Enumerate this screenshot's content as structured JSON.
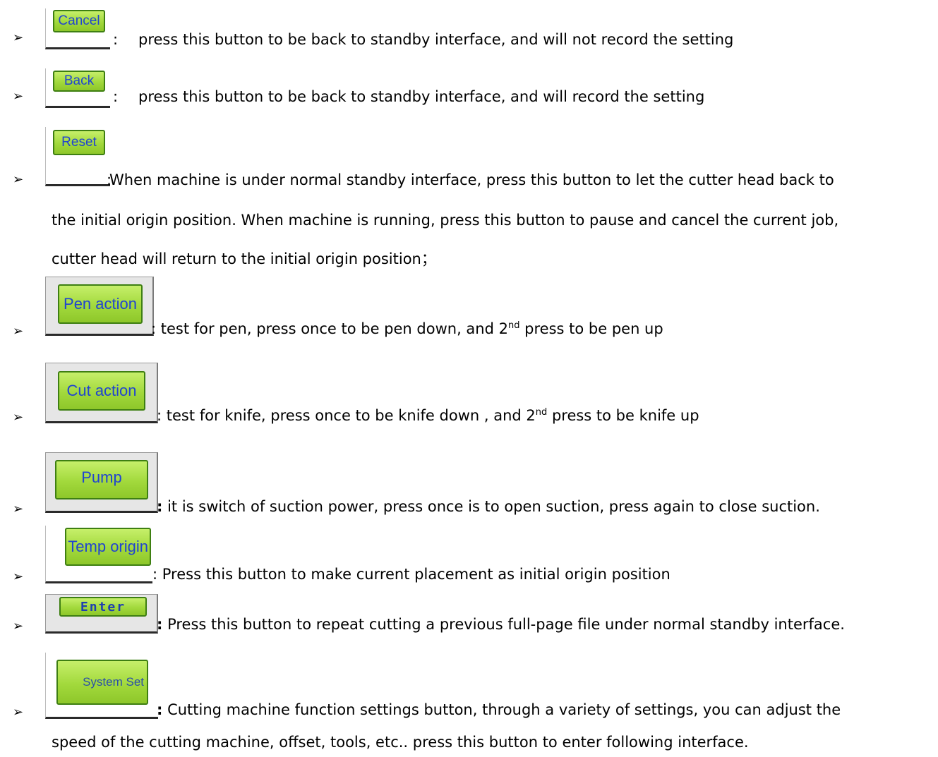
{
  "items": [
    {
      "button": "Cancel",
      "sep": ":",
      "text": "press this button to be back to standby interface, and will not record the setting"
    },
    {
      "button": "Back",
      "sep": ":",
      "text": "press this button to be back to standby interface, and will record the setting"
    },
    {
      "button": "Reset",
      "sep": ":",
      "line1": " When machine is under normal standby interface, press this button to let the cutter head back to",
      "line2": "the initial origin position. When machine is running, press this button to pause and cancel the current job,",
      "line3": "cutter head will return to the initial origin position；"
    },
    {
      "button": "Pen action",
      "sep": ":",
      "text_a": " test for pen, press once to be pen down, and 2",
      "sup": "nd",
      "text_b": " press to be pen up"
    },
    {
      "button": "Cut action",
      "sep": ":",
      "text_a": " test for knife, press once to be knife down , and 2",
      "sup": "nd",
      "text_b": " press to be knife up"
    },
    {
      "button": "Pump",
      "sep": ":",
      "text": " it is switch of suction power, press once is to open suction, press again to close suction."
    },
    {
      "button": "Temp origin",
      "sep": ":",
      "text": "  Press this button to make current placement as initial origin position"
    },
    {
      "button": "Enter",
      "sep": ":",
      "text": " Press this button to repeat cutting a previous full-page file under normal standby interface."
    },
    {
      "button": "System Set",
      "sep": ":",
      "line1": " Cutting machine function settings button, through a variety of settings, you can adjust the",
      "line2": "speed of the cutting machine, offset, tools, etc.. press this button to enter following interface."
    }
  ],
  "bullet_glyph": "➢"
}
